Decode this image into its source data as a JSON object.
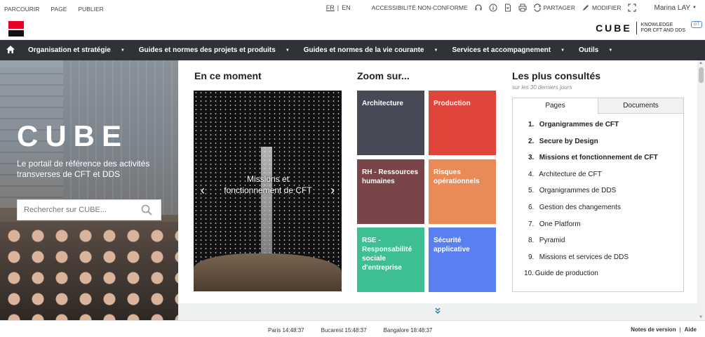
{
  "topbar": {
    "left_links": [
      "PARCOURIR",
      "PAGE",
      "PUBLIER"
    ],
    "lang_fr": "FR",
    "lang_sep": "|",
    "lang_en": "EN",
    "accessibility": "ACCESSIBILITÉ NON-CONFORME",
    "share": "PARTAGER",
    "edit": "MODIFIER",
    "user": "Marina LAY"
  },
  "brand": {
    "cube_word": "CUBE",
    "tagline_line1": "KNOWLEDGE",
    "tagline_line2": "FOR CFT AND DDS",
    "badge": "GT"
  },
  "nav": {
    "items": [
      "Organisation et stratégie",
      "Guides et normes des projets et produits",
      "Guides et normes de la vie courante",
      "Services et accompagnement",
      "Outils"
    ]
  },
  "hero": {
    "title": "CUBE",
    "subtitle": "Le portail de référence des activités transverses de CFT et DDS",
    "search_placeholder": "Rechercher sur CUBE..."
  },
  "moment": {
    "title": "En ce moment",
    "slide_caption": "Missions et fonctionnement de CFT"
  },
  "zoom": {
    "title": "Zoom sur...",
    "tiles": [
      {
        "label": "Architecture",
        "color": "#454a56"
      },
      {
        "label": "Production",
        "color": "#e0453c"
      },
      {
        "label": "RH - Ressources humaines",
        "color": "#7a4548"
      },
      {
        "label": "Risques opérationnels",
        "color": "#ea8b57"
      },
      {
        "label": "RSE - Responsabilité sociale d'entreprise",
        "color": "#3dbf93"
      },
      {
        "label": "Sécurité applicative",
        "color": "#5a7ff0"
      }
    ]
  },
  "popular": {
    "title": "Les plus consultés",
    "subtitle": "sur les 30 derniers jours",
    "tab_pages": "Pages",
    "tab_documents": "Documents",
    "items": [
      {
        "n": "1.",
        "label": "Organigrammes de CFT"
      },
      {
        "n": "2.",
        "label": "Secure by Design"
      },
      {
        "n": "3.",
        "label": "Missions et fonctionnement de CFT"
      },
      {
        "n": "4.",
        "label": "Architecture de CFT"
      },
      {
        "n": "5.",
        "label": "Organigrammes de DDS"
      },
      {
        "n": "6.",
        "label": "Gestion des changements"
      },
      {
        "n": "7.",
        "label": "One Platform"
      },
      {
        "n": "8.",
        "label": "Pyramid"
      },
      {
        "n": "9.",
        "label": "Missions et services de DDS"
      },
      {
        "n": "10.",
        "label": "Guide de production"
      }
    ]
  },
  "footer": {
    "clocks": [
      "Paris 14:48:37",
      "Bucarest 15:48:37",
      "Bangalore 18:48:37"
    ],
    "release_notes": "Notes de version",
    "sep": "|",
    "help": "Aide"
  }
}
